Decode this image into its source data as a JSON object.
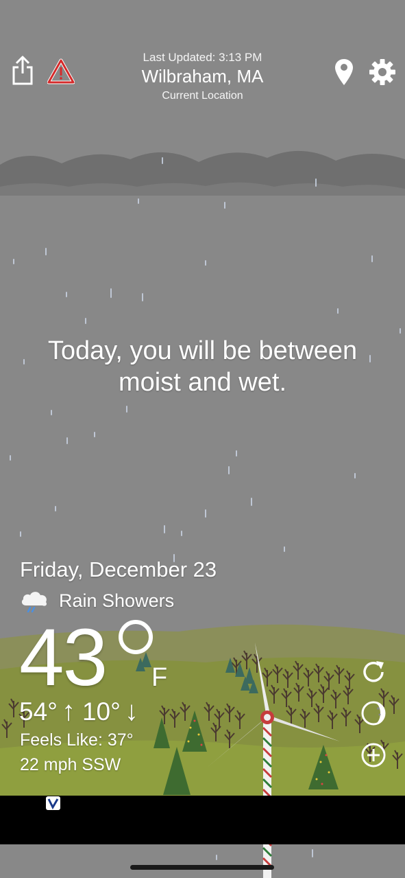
{
  "header": {
    "last_updated": "Last Updated: 3:13 PM",
    "city": "Wilbraham, MA",
    "location_label": "Current Location"
  },
  "icons": {
    "share": "share-icon",
    "alert": "warning-icon",
    "location": "map-pin-icon",
    "settings": "gear-icon",
    "refresh": "refresh-icon",
    "moon": "moon-phase-icon",
    "add": "add-location-icon",
    "condition": "rain-cloud-icon"
  },
  "forecast": {
    "tagline": "Today, you will be between moist and wet."
  },
  "current": {
    "date": "Friday, December 23",
    "condition": "Rain Showers",
    "temperature": "43",
    "unit": "F",
    "high": "54°",
    "low": "10°",
    "feels_like": "Feels Like: 37°",
    "wind": "22 mph SSW"
  },
  "colors": {
    "sky": "#888888",
    "cloud": "#6e6e6e",
    "hill_far": "#8a8f5a",
    "hill_near": "#8b9a3e",
    "alert_red": "#d42b2b",
    "tree_green": "#3f6b2f",
    "ad_bar": "#000000"
  }
}
